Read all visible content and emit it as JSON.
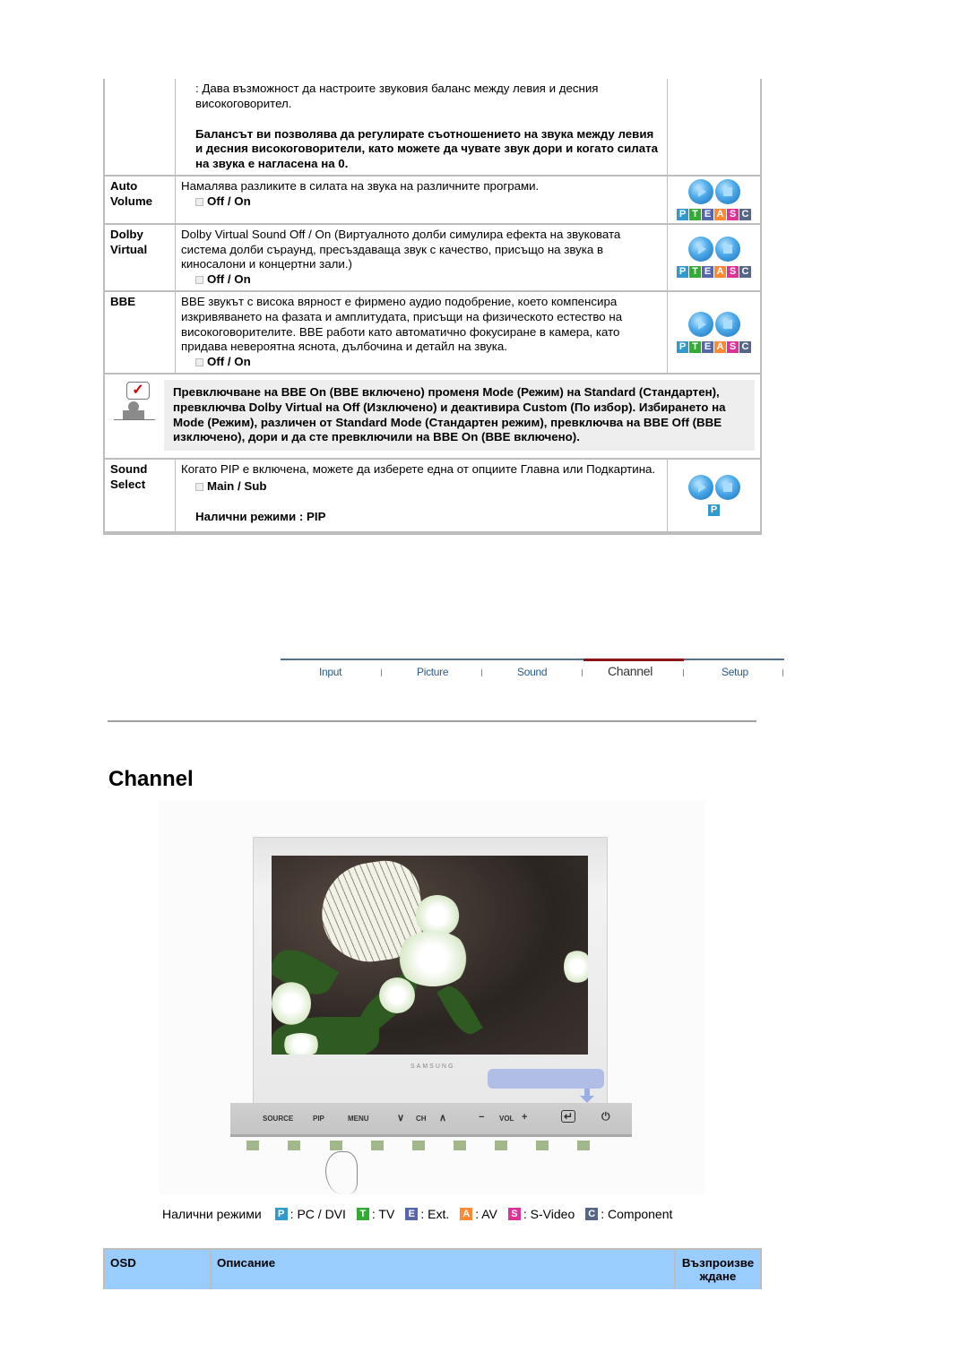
{
  "sound_table": {
    "balance_continuation": {
      "text": ": Дава възможност да настроите звуковия баланс между левия и десния високоговорител.",
      "bold_text": "Балансът ви позволява да регулирате съотношението на звука между левия и десния високоговорители, като можете да чувате звук дори и когато силата на звука е нагласена на 0."
    },
    "rows": [
      {
        "name": "Auto Volume",
        "description": "Намалява разликите в силата на звука на различните програми.",
        "option": "Off / On",
        "modes": [
          "P",
          "T",
          "E",
          "A",
          "S",
          "C"
        ]
      },
      {
        "name": "Dolby Virtual",
        "description": "Dolby Virtual Sound Off / On (Виртуалното долби симулира ефекта на звуковата система долби съраунд, пресъздаваща звук с качество, присъщо на звука в киносалони и концертни зали.)",
        "option": "Off / On",
        "modes": [
          "P",
          "T",
          "E",
          "A",
          "S",
          "C"
        ]
      },
      {
        "name": "BBE",
        "description": "BBE звукът с висока вярност е фирмено аудио подобрение, което компенсира изкривяването на фазата и амплитудата, присъщи на физическото естество на високоговорителите. BBE работи като автоматично фокусиране в камера, като придава невероятна яснота, дълбочина и детайл на звука.",
        "option": "Off / On",
        "modes": [
          "P",
          "T",
          "E",
          "A",
          "S",
          "C"
        ]
      }
    ],
    "note": "Превключване на BBE On (BBE включено) променя Mode (Режим) на Standard (Стандартен), превключва Dolby Virtual на Off (Изключено) и деактивира Custom (По избор). Избирането на Mode (Режим), различен от Standard Mode (Стандартен режим), превключва на BBE Off (BBE изключено), дори и да сте превключили на BBE On (BBE включено).",
    "sound_select": {
      "name": "Sound Select",
      "description": "Когато PIP е включена, можете да изберете една от опциите Главна или Подкартина.",
      "option": "Main / Sub",
      "available": "Налични режими : PIP",
      "modes": [
        "P"
      ]
    }
  },
  "nav_tabs": [
    {
      "label": "Input",
      "active": false
    },
    {
      "label": "Picture",
      "active": false
    },
    {
      "label": "Sound",
      "active": false
    },
    {
      "label": "Channel",
      "active": true
    },
    {
      "label": "Setup",
      "active": false
    }
  ],
  "section_title": "Channel",
  "monitor": {
    "brand": "SAMSUNG",
    "buttons": [
      "SOURCE",
      "PIP",
      "MENU",
      "∨",
      "CH",
      "∧",
      "−",
      "VOL",
      "+",
      "↵",
      "⏻"
    ]
  },
  "legend": {
    "label": "Налични режими",
    "items": [
      {
        "badge": "P",
        "text": ": PC / DVI",
        "color": "#3399cc"
      },
      {
        "badge": "T",
        "text": ": TV",
        "color": "#33aa33"
      },
      {
        "badge": "E",
        "text": ": Ext.",
        "color": "#5566aa"
      },
      {
        "badge": "A",
        "text": ": AV",
        "color": "#ff8833"
      },
      {
        "badge": "S",
        "text": ": S-Video",
        "color": "#dd3399"
      },
      {
        "badge": "C",
        "text": ": Component",
        "color": "#556688"
      }
    ]
  },
  "channel_table_header": {
    "col1": "OSD",
    "col2": "Описание",
    "col3": "Възпроизвеждане"
  },
  "colors": {
    "header_bg": "#99ccff",
    "active_tab_line": "#8b1515",
    "note_bg": "#eeeeee"
  }
}
